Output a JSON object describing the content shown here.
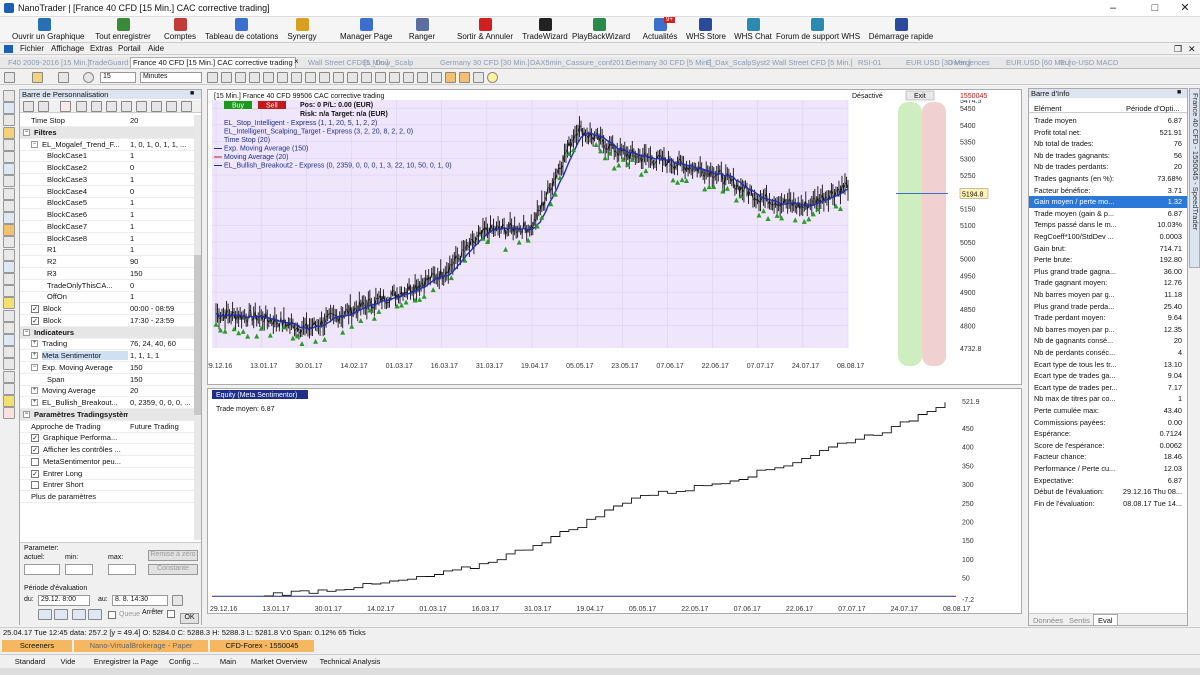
{
  "window": {
    "title": "NanoTrader | [France 40 CFD [15 Min.]  CAC corrective trading]"
  },
  "ribbon": [
    {
      "label": "Ouvrir un Graphique",
      "icon": "chart-open-icon",
      "color": "#2a6fb4"
    },
    {
      "label": "Tout enregistrer",
      "icon": "save-all-icon",
      "color": "#3a8a3a"
    },
    {
      "label": "Comptes",
      "icon": "accounts-icon",
      "color": "#c23b3b"
    },
    {
      "label": "Tableau de cotations",
      "icon": "quote-board-icon",
      "color": "#3a6fd0"
    },
    {
      "label": "Synergy",
      "icon": "synergy-icon",
      "color": "#d8a020"
    },
    {
      "label": "Manager Page",
      "icon": "page-manager-icon",
      "color": "#3a6fd0"
    },
    {
      "label": "Ranger",
      "icon": "arrange-icon",
      "color": "#5a6fa0"
    },
    {
      "label": "Sortir & Annuler",
      "icon": "exit-cancel-icon",
      "color": "#d02020"
    },
    {
      "label": "TradeWizard",
      "icon": "dollar-icon",
      "color": "#222222"
    },
    {
      "label": "PlayBackWizard",
      "icon": "playback-icon",
      "color": "#2a8a4a"
    },
    {
      "label": "Actualités",
      "icon": "news-icon",
      "color": "#3a6fd0",
      "badge": "9+"
    },
    {
      "label": "WHS Store",
      "icon": "store-icon",
      "color": "#2a4a9a"
    },
    {
      "label": "WHS Chat",
      "icon": "chat-icon",
      "color": "#2a8ab0"
    },
    {
      "label": "Forum de support WHS",
      "icon": "forum-icon",
      "color": "#2a8ab0"
    },
    {
      "label": "Démarrage rapide",
      "icon": "quick-start-icon",
      "color": "#2a4a9a"
    }
  ],
  "menu": [
    "Fichier",
    "Affichage",
    "Extras",
    "Portail",
    "Aide"
  ],
  "tabs": [
    {
      "label": "F40 2009-2016 [15 Min.]",
      "active": false
    },
    {
      "label": "TradeGuard",
      "active": false
    },
    {
      "label": "France 40 CFD [15 Min.]  CAC corrective trading",
      "active": true
    },
    {
      "label": "Wall Street CFD [5 Min.]",
      "active": false
    },
    {
      "label": "EL_Dow_Scalp",
      "active": false
    },
    {
      "label": "Germany 30 CFD [30 Min.]",
      "active": false
    },
    {
      "label": "DAX5min_Cassure_conf2017",
      "active": false
    },
    {
      "label": "Germany 30 CFD [5 Min.]",
      "active": false
    },
    {
      "label": "E_Dax_ScalpSyst2",
      "active": false
    },
    {
      "label": "Wall Street CFD [5 Min.]",
      "active": false
    },
    {
      "label": "RSI-01",
      "active": false
    },
    {
      "label": "EUR.USD [30 Min.]",
      "active": false
    },
    {
      "label": "Divergences",
      "active": false
    },
    {
      "label": "EUR.USD [60 Min.]",
      "active": false
    },
    {
      "label": "Euro-USD MACD",
      "active": false
    }
  ],
  "toolbar2": {
    "period_value": "15",
    "period_unit": "Minutes"
  },
  "leftpanel": {
    "title": "Barre de Personnalisation",
    "rows": [
      {
        "name": "Time Stop",
        "value": "20",
        "indent": 1,
        "kind": "plain"
      },
      {
        "name": "Filtres",
        "value": "",
        "indent": 0,
        "kind": "section"
      },
      {
        "name": "EL_Mogalef_Trend_F...",
        "value": "1, 0, 1, 0, 1, 1, ...",
        "indent": 1,
        "kind": "expand-open"
      },
      {
        "name": "BlockCase1",
        "value": "1",
        "indent": 3,
        "kind": "plain"
      },
      {
        "name": "BlockCase2",
        "value": "0",
        "indent": 3,
        "kind": "plain"
      },
      {
        "name": "BlockCase3",
        "value": "1",
        "indent": 3,
        "kind": "plain"
      },
      {
        "name": "BlockCase4",
        "value": "0",
        "indent": 3,
        "kind": "plain"
      },
      {
        "name": "BlockCase5",
        "value": "1",
        "indent": 3,
        "kind": "plain"
      },
      {
        "name": "BlockCase6",
        "value": "1",
        "indent": 3,
        "kind": "plain"
      },
      {
        "name": "BlockCase7",
        "value": "1",
        "indent": 3,
        "kind": "plain"
      },
      {
        "name": "BlockCase8",
        "value": "1",
        "indent": 3,
        "kind": "plain"
      },
      {
        "name": "R1",
        "value": "1",
        "indent": 3,
        "kind": "plain"
      },
      {
        "name": "R2",
        "value": "90",
        "indent": 3,
        "kind": "plain"
      },
      {
        "name": "R3",
        "value": "150",
        "indent": 3,
        "kind": "plain"
      },
      {
        "name": "TradeOnlyThisCA...",
        "value": "0",
        "indent": 3,
        "kind": "plain"
      },
      {
        "name": "OffOn",
        "value": "1",
        "indent": 3,
        "kind": "plain"
      },
      {
        "name": "Block",
        "value": "00:00 - 08:59",
        "indent": 1,
        "kind": "check"
      },
      {
        "name": "Block",
        "value": "17:30 - 23:59",
        "indent": 1,
        "kind": "check"
      },
      {
        "name": "Indicateurs",
        "value": "",
        "indent": 0,
        "kind": "section"
      },
      {
        "name": "Trading",
        "value": "76, 24, 40, 60",
        "indent": 1,
        "kind": "expand"
      },
      {
        "name": "Meta Sentimentor",
        "value": "1, 1, 1, 1",
        "indent": 1,
        "kind": "expand-hl"
      },
      {
        "name": "Exp. Moving Average",
        "value": "150",
        "indent": 1,
        "kind": "expand-open"
      },
      {
        "name": "Span",
        "value": "150",
        "indent": 3,
        "kind": "plain"
      },
      {
        "name": "Moving Average",
        "value": "20",
        "indent": 1,
        "kind": "expand"
      },
      {
        "name": "EL_Bullish_Breakout...",
        "value": "0, 2359, 0, 0, 0, ...",
        "indent": 1,
        "kind": "expand"
      },
      {
        "name": "Paramètres Tradingsystème",
        "value": "",
        "indent": 0,
        "kind": "section"
      },
      {
        "name": "Approche de Trading",
        "value": "Future Trading",
        "indent": 1,
        "kind": "plain"
      },
      {
        "name": "Graphique Performa...",
        "value": "",
        "indent": 1,
        "kind": "check"
      },
      {
        "name": "Afficher les contrôles ...",
        "value": "",
        "indent": 1,
        "kind": "check"
      },
      {
        "name": "MetaSentimentor peu...",
        "value": "",
        "indent": 1,
        "kind": "uncheck"
      },
      {
        "name": "Entrer Long",
        "value": "",
        "indent": 1,
        "kind": "check"
      },
      {
        "name": "Entrer Short",
        "value": "",
        "indent": 1,
        "kind": "uncheck"
      },
      {
        "name": "Plus de paramètres",
        "value": "",
        "indent": 1,
        "kind": "plain"
      }
    ],
    "bottom": {
      "param_label": "Parameter:",
      "actuel": "actuel:",
      "min": "min:",
      "max": "max:",
      "reset_btn": "Remise à zéro",
      "const_btn": "Constante",
      "period_label": "Période d'évaluation",
      "du": "du:",
      "du_value": "29.12.  8:00",
      "au": "au:",
      "au_value": "8.  8. 14:30",
      "queue": "Queue",
      "arrete": "Arrêter",
      "ok": "OK"
    }
  },
  "chart1": {
    "header": "[15 Min.] France 40 CFD    99506 CAC corrective trading",
    "buy": "Buy",
    "sell": "Sell",
    "pos": "Pos: 0  P/L: 0.00  (EUR)",
    "risk": "Risk: n/a  Target: n/a (EUR)",
    "legend": [
      "EL_Stop_Intelligent - Express  (1, 1, 20, 5, 1, 2, 2)",
      "EL_Intelligent_Scalping_Target - Express  (3, 2, 20, 8, 2, 2, 0)",
      "Time Stop  (20)",
      "Exp. Moving Average  (150)",
      "Moving Average  (20)",
      "EL_Bullish_Breakout2 - Express  (0, 2359, 0, 0, 0, 1, 3, 22, 10, 50, 0, 1, 0)"
    ],
    "desactive": "Désactivé",
    "exit": "Exit",
    "account": "1550045",
    "current_price": "5194.8",
    "price_labels": [
      "5474.5",
      "5450",
      "5400",
      "5350",
      "5300",
      "5250",
      "5200",
      "5150",
      "5100",
      "5050",
      "5000",
      "4950",
      "4900",
      "4850",
      "4800",
      "4732.8"
    ],
    "date_labels": [
      "29.12.16",
      "13.01.17",
      "30.01.17",
      "14.02.17",
      "01.03.17",
      "16.03.17",
      "31.03.17",
      "19.04.17",
      "05.05.17",
      "23.05.17",
      "07.06.17",
      "22.06.17",
      "07.07.17",
      "24.07.17",
      "08.08.17"
    ]
  },
  "chart2": {
    "legend": "Equity (Meta Sentimentor)",
    "trade_moyen": "Trade moyen: 6.87",
    "y_labels": [
      "521.9",
      "450",
      "400",
      "350",
      "300",
      "250",
      "200",
      "150",
      "100",
      "50",
      "-7.2"
    ],
    "date_labels": [
      "29.12.16",
      "13.01.17",
      "30.01.17",
      "14.02.17",
      "01.03.17",
      "16.03.17",
      "31.03.17",
      "19.04.17",
      "05.05.17",
      "22.05.17",
      "07.06.17",
      "22.06.17",
      "07.07.17",
      "24.07.17",
      "08.08.17"
    ]
  },
  "chart_data": [
    {
      "type": "line",
      "title": "[15 Min.] France 40 CFD    99506 CAC corrective trading",
      "x": [
        "29.12.16",
        "13.01.17",
        "30.01.17",
        "14.02.17",
        "01.03.17",
        "16.03.17",
        "31.03.17",
        "19.04.17",
        "05.05.17",
        "23.05.17",
        "07.06.17",
        "22.06.17",
        "07.07.17",
        "24.07.17",
        "08.08.17"
      ],
      "series": [
        {
          "name": "France 40 CFD",
          "values": [
            4835,
            4825,
            4790,
            4845,
            4895,
            4955,
            5085,
            5095,
            5390,
            5315,
            5290,
            5260,
            5185,
            5155,
            5220
          ]
        }
      ],
      "ylim": [
        4732.8,
        5474.5
      ],
      "current": 5194.8
    },
    {
      "type": "line",
      "title": "Equity (Meta Sentimentor)",
      "x": [
        "29.12.16",
        "13.01.17",
        "30.01.17",
        "14.02.17",
        "01.03.17",
        "16.03.17",
        "31.03.17",
        "19.04.17",
        "05.05.17",
        "22.05.17",
        "07.06.17",
        "22.06.17",
        "07.07.17",
        "24.07.17",
        "08.08.17"
      ],
      "series": [
        {
          "name": "Equity (Meta Sentimentor)",
          "values": [
            0,
            5,
            15,
            30,
            50,
            80,
            130,
            190,
            265,
            285,
            315,
            355,
            410,
            450,
            521.9
          ]
        }
      ],
      "ylim": [
        -7.2,
        521.9
      ]
    }
  ],
  "rightpanel": {
    "title": "Barre d'Info",
    "col1": "Elément",
    "col2": "Période d'Opti...",
    "rows": [
      {
        "n": "Trade moyen",
        "v": "6.87"
      },
      {
        "n": "Profit total net:",
        "v": "521.91"
      },
      {
        "n": "Nb total de trades:",
        "v": "76"
      },
      {
        "n": "Nb de trades gagnants:",
        "v": "56"
      },
      {
        "n": "Nb de trades perdants:",
        "v": "20"
      },
      {
        "n": "Trades gagnants (en %):",
        "v": "73.68%"
      },
      {
        "n": "Facteur bénéfice:",
        "v": "3.71"
      },
      {
        "n": "Gain moyen / perte mo...",
        "v": "1.32",
        "hl": true
      },
      {
        "n": "Trade moyen (gain & p...",
        "v": "6.87"
      },
      {
        "n": "Temps passé dans le m...",
        "v": "10.03%"
      },
      {
        "n": "RegCoeff*100/StdDev ...",
        "v": "0.0003"
      },
      {
        "n": "Gain brut:",
        "v": "714.71"
      },
      {
        "n": "Perte brute:",
        "v": "192.80"
      },
      {
        "n": "Plus grand trade gagna...",
        "v": "36.00"
      },
      {
        "n": "Trade gagnant moyen:",
        "v": "12.76"
      },
      {
        "n": "Nb barres moyen par g...",
        "v": "11.18"
      },
      {
        "n": "Plus grand trade perda...",
        "v": "25.40"
      },
      {
        "n": "Trade perdant moyen:",
        "v": "9.64"
      },
      {
        "n": "Nb barres moyen par p...",
        "v": "12.35"
      },
      {
        "n": "Nb de gagnants consé...",
        "v": "20"
      },
      {
        "n": "Nb de perdants conséc...",
        "v": "4"
      },
      {
        "n": "Ecart type de tous les tr...",
        "v": "13.10"
      },
      {
        "n": "Ecart type de trades ga...",
        "v": "9.04"
      },
      {
        "n": "Ecart type de trades per...",
        "v": "7.17"
      },
      {
        "n": "Nb max de titres par co...",
        "v": "1"
      },
      {
        "n": "Perte cumulée max:",
        "v": "43.40"
      },
      {
        "n": "Commissions payées:",
        "v": "0.00"
      },
      {
        "n": "Espérance:",
        "v": "0.7124"
      },
      {
        "n": "Score de l'espérance:",
        "v": "0.0062"
      },
      {
        "n": "Facteur chance:",
        "v": "18.46"
      },
      {
        "n": "Performance / Perte cu...",
        "v": "12.03"
      },
      {
        "n": "Expectative:",
        "v": "6.87"
      },
      {
        "n": "Début de l'évaluation:",
        "v": "29.12.16 Thu 08..."
      },
      {
        "n": "Fin de l'évaluation:",
        "v": "08.08.17 Tue 14..."
      }
    ],
    "bottom_tabs": [
      "Données",
      "Sentis",
      "Eval"
    ],
    "vtab": "France 40 CFD - 1550045 - SpeedTrader"
  },
  "statusbar": "25.04.17 Tue  12:45 data: 257.2 [y = 49.4]   O: 5284.0  C: 5288.3  H: 5288.3  L: 5281.8  V:0  Span: 0.12%  65 Ticks",
  "bottomtabs1": [
    "Screeners",
    "Nano-VirtualBrokerage - Paper",
    "CFD-Forex - 1550045"
  ],
  "bottomtabs2": [
    "Standard",
    "Vide",
    "Enregistrer la Page",
    "Config ...",
    "Main",
    "Market Overview",
    "Technical Analysis"
  ]
}
